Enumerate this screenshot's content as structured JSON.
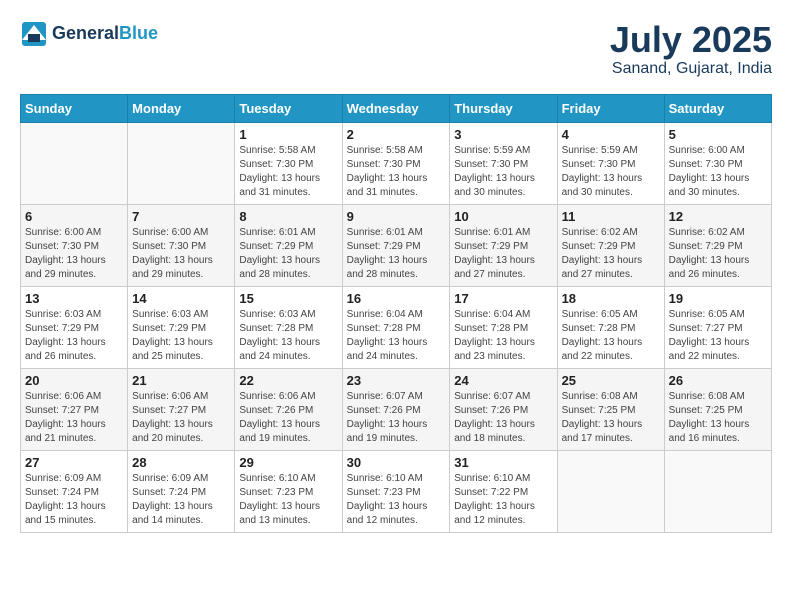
{
  "header": {
    "logo_line1": "General",
    "logo_line2": "Blue",
    "month_year": "July 2025",
    "location": "Sanand, Gujarat, India"
  },
  "weekdays": [
    "Sunday",
    "Monday",
    "Tuesday",
    "Wednesday",
    "Thursday",
    "Friday",
    "Saturday"
  ],
  "weeks": [
    [
      {
        "day": "",
        "info": ""
      },
      {
        "day": "",
        "info": ""
      },
      {
        "day": "1",
        "info": "Sunrise: 5:58 AM\nSunset: 7:30 PM\nDaylight: 13 hours and 31 minutes."
      },
      {
        "day": "2",
        "info": "Sunrise: 5:58 AM\nSunset: 7:30 PM\nDaylight: 13 hours and 31 minutes."
      },
      {
        "day": "3",
        "info": "Sunrise: 5:59 AM\nSunset: 7:30 PM\nDaylight: 13 hours and 30 minutes."
      },
      {
        "day": "4",
        "info": "Sunrise: 5:59 AM\nSunset: 7:30 PM\nDaylight: 13 hours and 30 minutes."
      },
      {
        "day": "5",
        "info": "Sunrise: 6:00 AM\nSunset: 7:30 PM\nDaylight: 13 hours and 30 minutes."
      }
    ],
    [
      {
        "day": "6",
        "info": "Sunrise: 6:00 AM\nSunset: 7:30 PM\nDaylight: 13 hours and 29 minutes."
      },
      {
        "day": "7",
        "info": "Sunrise: 6:00 AM\nSunset: 7:30 PM\nDaylight: 13 hours and 29 minutes."
      },
      {
        "day": "8",
        "info": "Sunrise: 6:01 AM\nSunset: 7:29 PM\nDaylight: 13 hours and 28 minutes."
      },
      {
        "day": "9",
        "info": "Sunrise: 6:01 AM\nSunset: 7:29 PM\nDaylight: 13 hours and 28 minutes."
      },
      {
        "day": "10",
        "info": "Sunrise: 6:01 AM\nSunset: 7:29 PM\nDaylight: 13 hours and 27 minutes."
      },
      {
        "day": "11",
        "info": "Sunrise: 6:02 AM\nSunset: 7:29 PM\nDaylight: 13 hours and 27 minutes."
      },
      {
        "day": "12",
        "info": "Sunrise: 6:02 AM\nSunset: 7:29 PM\nDaylight: 13 hours and 26 minutes."
      }
    ],
    [
      {
        "day": "13",
        "info": "Sunrise: 6:03 AM\nSunset: 7:29 PM\nDaylight: 13 hours and 26 minutes."
      },
      {
        "day": "14",
        "info": "Sunrise: 6:03 AM\nSunset: 7:29 PM\nDaylight: 13 hours and 25 minutes."
      },
      {
        "day": "15",
        "info": "Sunrise: 6:03 AM\nSunset: 7:28 PM\nDaylight: 13 hours and 24 minutes."
      },
      {
        "day": "16",
        "info": "Sunrise: 6:04 AM\nSunset: 7:28 PM\nDaylight: 13 hours and 24 minutes."
      },
      {
        "day": "17",
        "info": "Sunrise: 6:04 AM\nSunset: 7:28 PM\nDaylight: 13 hours and 23 minutes."
      },
      {
        "day": "18",
        "info": "Sunrise: 6:05 AM\nSunset: 7:28 PM\nDaylight: 13 hours and 22 minutes."
      },
      {
        "day": "19",
        "info": "Sunrise: 6:05 AM\nSunset: 7:27 PM\nDaylight: 13 hours and 22 minutes."
      }
    ],
    [
      {
        "day": "20",
        "info": "Sunrise: 6:06 AM\nSunset: 7:27 PM\nDaylight: 13 hours and 21 minutes."
      },
      {
        "day": "21",
        "info": "Sunrise: 6:06 AM\nSunset: 7:27 PM\nDaylight: 13 hours and 20 minutes."
      },
      {
        "day": "22",
        "info": "Sunrise: 6:06 AM\nSunset: 7:26 PM\nDaylight: 13 hours and 19 minutes."
      },
      {
        "day": "23",
        "info": "Sunrise: 6:07 AM\nSunset: 7:26 PM\nDaylight: 13 hours and 19 minutes."
      },
      {
        "day": "24",
        "info": "Sunrise: 6:07 AM\nSunset: 7:26 PM\nDaylight: 13 hours and 18 minutes."
      },
      {
        "day": "25",
        "info": "Sunrise: 6:08 AM\nSunset: 7:25 PM\nDaylight: 13 hours and 17 minutes."
      },
      {
        "day": "26",
        "info": "Sunrise: 6:08 AM\nSunset: 7:25 PM\nDaylight: 13 hours and 16 minutes."
      }
    ],
    [
      {
        "day": "27",
        "info": "Sunrise: 6:09 AM\nSunset: 7:24 PM\nDaylight: 13 hours and 15 minutes."
      },
      {
        "day": "28",
        "info": "Sunrise: 6:09 AM\nSunset: 7:24 PM\nDaylight: 13 hours and 14 minutes."
      },
      {
        "day": "29",
        "info": "Sunrise: 6:10 AM\nSunset: 7:23 PM\nDaylight: 13 hours and 13 minutes."
      },
      {
        "day": "30",
        "info": "Sunrise: 6:10 AM\nSunset: 7:23 PM\nDaylight: 13 hours and 12 minutes."
      },
      {
        "day": "31",
        "info": "Sunrise: 6:10 AM\nSunset: 7:22 PM\nDaylight: 13 hours and 12 minutes."
      },
      {
        "day": "",
        "info": ""
      },
      {
        "day": "",
        "info": ""
      }
    ]
  ]
}
